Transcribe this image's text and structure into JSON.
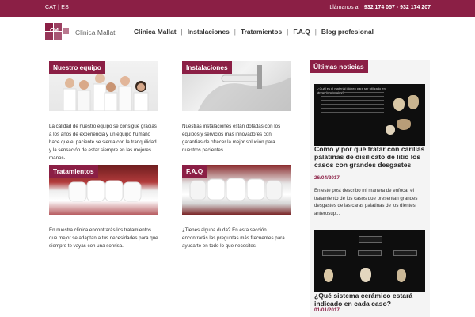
{
  "topbar": {
    "lang": "CAT | ES",
    "phone_prefix": "Llámanos al",
    "phone_numbers": "932 174 057 - 932 174 207"
  },
  "brand": {
    "logo_word": "Clinica Mallat",
    "logo_mark": "CM"
  },
  "nav": {
    "items": [
      "Clinica Mallat",
      "Instalaciones",
      "Tratamientos",
      "F.A.Q",
      "Blog profesional"
    ],
    "separator": "|"
  },
  "cards": {
    "team": {
      "label": "Nuestro equipo",
      "text": "La calidad de nuestro equipo se consigue gracias a los años de experiencia y un equipo humano hace que el paciente se sienta con la tranquilidad y la sensación de estar siempre en las mejores manos."
    },
    "installations": {
      "label": "Instalaciones",
      "text": "Nuestras instalaciones están dotadas con los equipos y servicios más innovadores con garantías de ofrecer la mejor solución para nuestros pacientes."
    },
    "treatments": {
      "label": "Tratamientos",
      "text": "En nuestra clínica encontrarás los tratamientos que mejor se adaptan a tus necesidades para que siempre te vayas con una sonrisa."
    },
    "faq": {
      "label": "F.A.Q",
      "text": "¿Tienes alguna duda? En esta sección encontrarás las preguntas más frecuentes para ayudarte en todo lo que necesites."
    }
  },
  "sidebar": {
    "title": "Últimas noticias",
    "news": [
      {
        "image_caption": "¿Cuál es el material idóneo para ser utilizado en áreas funcionales?",
        "title": "Cómo y por qué tratar con carillas palatinas de disilicato de litio los casos con grandes desgastes",
        "date": "26/04/2017",
        "excerpt": "En este post describo mi manera de enfocar el tratamiento de los casos que presentan grandes desgastes de las caras palatinas de los dientes anterosup..."
      },
      {
        "image_caption": "",
        "title": "¿Qué sistema cerámico estará indicado en cada caso?",
        "date": "01/01/2017",
        "excerpt": ""
      }
    ]
  },
  "colors": {
    "brand": "#8b1f45",
    "sidebar_bg": "#f4f4f4"
  }
}
